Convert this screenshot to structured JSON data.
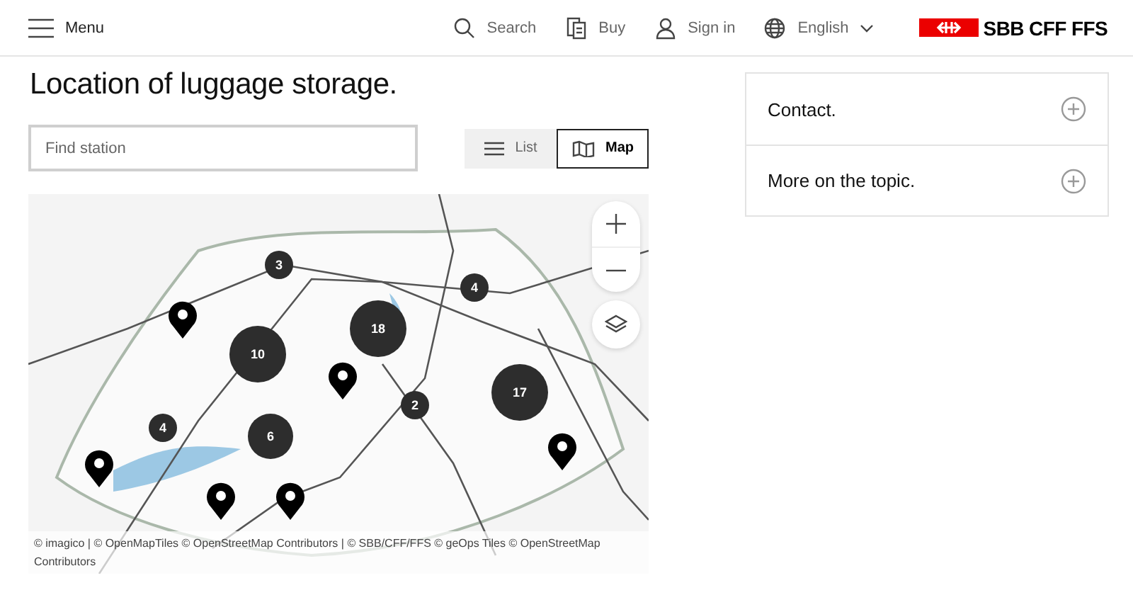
{
  "header": {
    "menu": "Menu",
    "nav": [
      {
        "kind": "search",
        "label": "Search"
      },
      {
        "kind": "buy",
        "label": "Buy"
      },
      {
        "kind": "user",
        "label": "Sign in"
      },
      {
        "kind": "globe",
        "label": "English"
      }
    ],
    "logo": "SBB CFF FFS"
  },
  "title": "Location of luggage storage.",
  "search": {
    "placeholder": "Find station"
  },
  "view_toggle": [
    {
      "kind": "list",
      "label": "List",
      "selected": false
    },
    {
      "kind": "map",
      "label": "Map",
      "selected": true
    }
  ],
  "map": {
    "markers": [
      {
        "kind": "cluster",
        "count": "3"
      },
      {
        "kind": "cluster",
        "count": "4"
      },
      {
        "kind": "cluster",
        "count": "18"
      },
      {
        "kind": "cluster",
        "count": "10"
      },
      {
        "kind": "cluster",
        "count": "17"
      },
      {
        "kind": "cluster",
        "count": "2"
      },
      {
        "kind": "cluster",
        "count": "4"
      },
      {
        "kind": "cluster",
        "count": "6"
      },
      {
        "kind": "pin"
      },
      {
        "kind": "pin"
      },
      {
        "kind": "pin"
      },
      {
        "kind": "pin"
      },
      {
        "kind": "pin"
      },
      {
        "kind": "pin"
      }
    ],
    "attribution": "© imagico | © OpenMapTiles © OpenStreetMap Contributors | © SBB/CFF/FFS © geOps Tiles © OpenStreetMap Contributors"
  },
  "accordion": [
    {
      "label": "Contact.",
      "expanded": false
    },
    {
      "label": "More on the topic.",
      "expanded": false
    }
  ]
}
